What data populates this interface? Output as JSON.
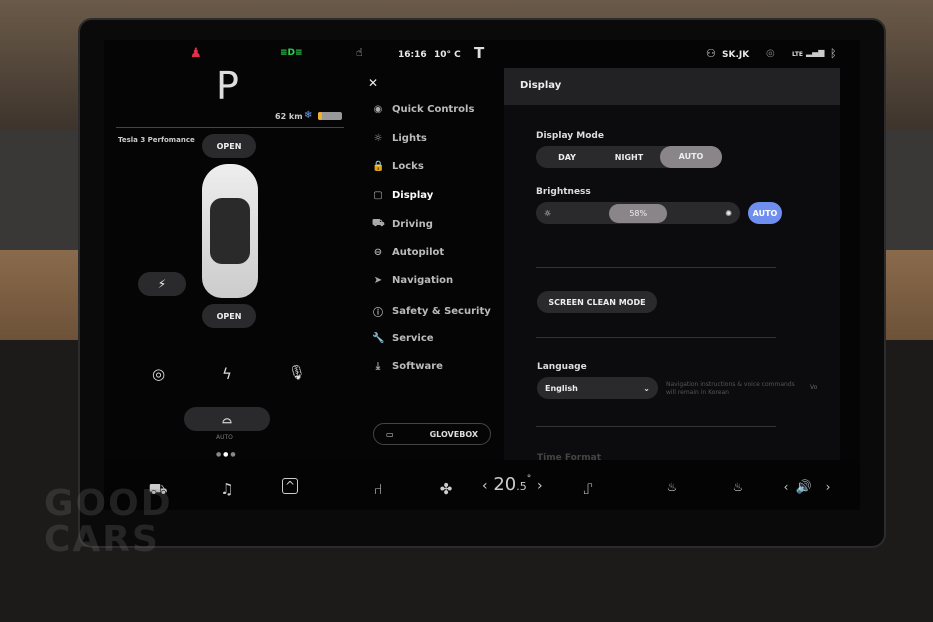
{
  "status": {
    "time": "16:16",
    "temp": "10° C",
    "user": "SK.JK",
    "network": "LTE"
  },
  "left": {
    "gear": "P",
    "range": "62 km",
    "car_name": "Tesla 3 Perfomance",
    "frunk": "OPEN",
    "trunk": "OPEN",
    "wiper_mode": "AUTO"
  },
  "menu": {
    "close": "✕",
    "items": [
      {
        "label": "Quick Controls",
        "icon": "toggle-icon"
      },
      {
        "label": "Lights",
        "icon": "light-icon"
      },
      {
        "label": "Locks",
        "icon": "lock-icon"
      },
      {
        "label": "Display",
        "icon": "display-icon",
        "active": true
      },
      {
        "label": "Driving",
        "icon": "car-icon"
      },
      {
        "label": "Autopilot",
        "icon": "steering-wheel-icon"
      },
      {
        "label": "Navigation",
        "icon": "navigation-icon"
      },
      {
        "label": "Safety & Security",
        "icon": "alert-icon"
      },
      {
        "label": "Service",
        "icon": "wrench-icon"
      },
      {
        "label": "Software",
        "icon": "download-icon"
      }
    ],
    "glovebox": "GLOVEBOX"
  },
  "display": {
    "title": "Display",
    "mode_label": "Display Mode",
    "modes": [
      "DAY",
      "NIGHT",
      "AUTO"
    ],
    "mode_selected": "AUTO",
    "brightness_label": "Brightness",
    "brightness": "58%",
    "brightness_auto": "AUTO",
    "screen_clean": "SCREEN CLEAN MODE",
    "language_label": "Language",
    "language": "English",
    "language_note": "Navigation instructions & voice commands will remain in Korean",
    "language_note2": "Vo",
    "time_format_label": "Time Format"
  },
  "bottom": {
    "temp_int": "20",
    "temp_dec": ".5",
    "temp_deg": "°",
    "prev": "‹",
    "next": "›"
  },
  "colors": {
    "accent": "#6f8ff0",
    "seatbelt": "#e0304a",
    "lights": "#2bd44a"
  },
  "watermark": "GOOD CARS"
}
